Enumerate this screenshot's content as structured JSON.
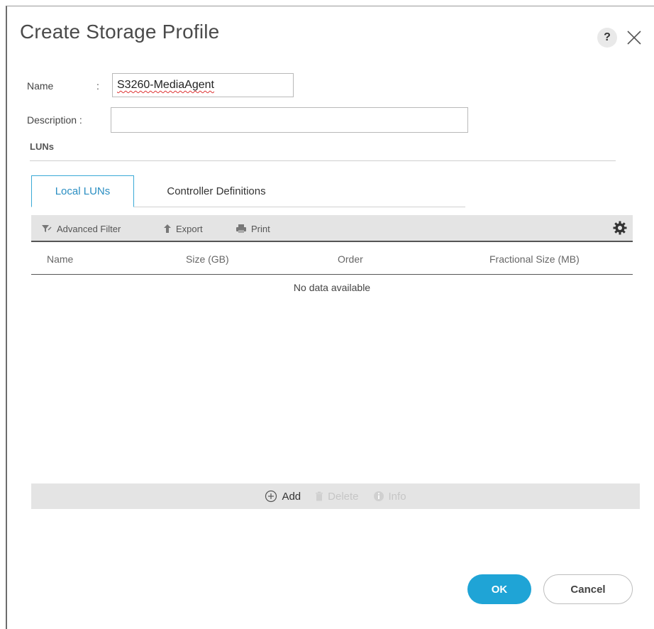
{
  "dialog": {
    "title": "Create Storage Profile",
    "help_label": "?"
  },
  "form": {
    "name_label": "Name",
    "name_colon": ":",
    "name_value": "S3260-MediaAgent",
    "description_label": "Description :",
    "description_value": ""
  },
  "luns": {
    "section_label": "LUNs",
    "tabs": [
      {
        "label": "Local LUNs",
        "active": true
      },
      {
        "label": "Controller Definitions",
        "active": false
      }
    ],
    "toolbar": {
      "advanced_filter": "Advanced Filter",
      "export": "Export",
      "print": "Print"
    },
    "columns": [
      "Name",
      "Size (GB)",
      "Order",
      "Fractional Size (MB)"
    ],
    "empty_message": "No data available",
    "actions": {
      "add": "Add",
      "delete": "Delete",
      "info": "Info"
    }
  },
  "footer": {
    "ok_label": "OK",
    "cancel_label": "Cancel"
  },
  "colors": {
    "accent": "#1fa4d6",
    "tab_active": "#2a8ec2",
    "toolbar_bg": "#e4e4e4",
    "disabled_text": "#c6c6c6"
  },
  "icons": [
    "help-icon",
    "close-icon",
    "filter-icon",
    "export-icon",
    "print-icon",
    "gear-icon",
    "add-icon",
    "delete-icon",
    "info-icon"
  ]
}
